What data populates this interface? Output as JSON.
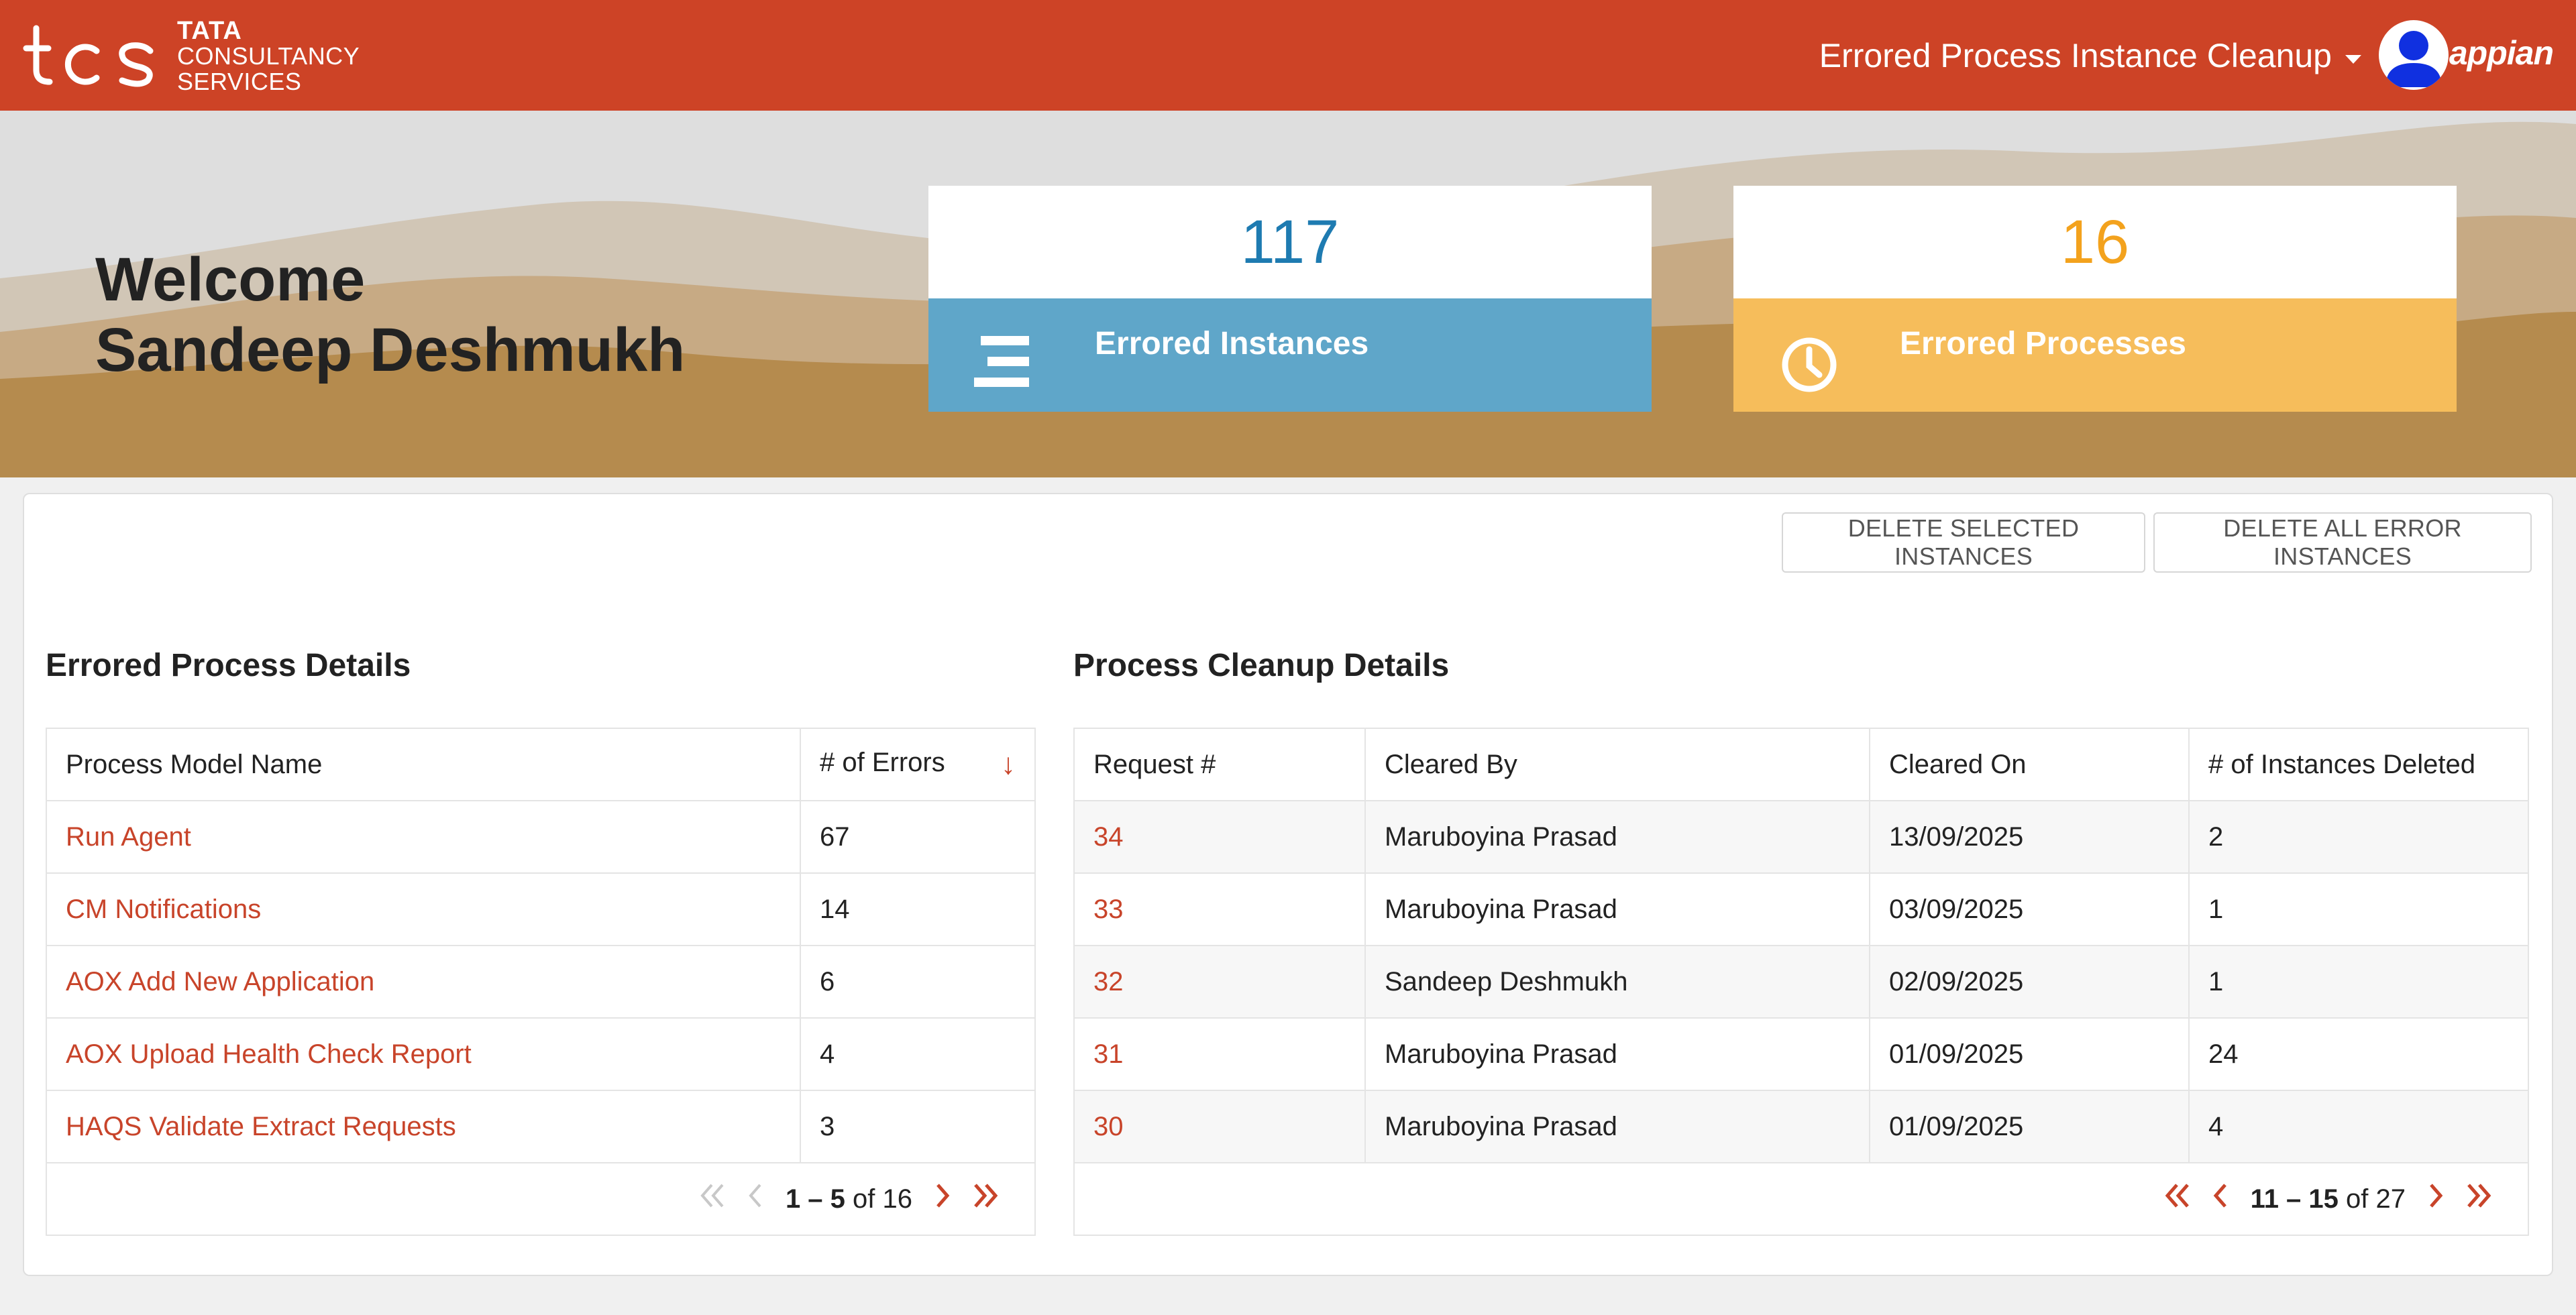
{
  "header": {
    "logo_line1": "TATA",
    "logo_line2": "CONSULTANCY",
    "logo_line3": "SERVICES",
    "app_title": "Errored Process Instance Cleanup",
    "brand": "appian"
  },
  "banner": {
    "welcome_line1": "Welcome",
    "welcome_line2": "Sandeep Deshmukh",
    "cards": [
      {
        "value": "117",
        "label": "Errored Instances",
        "icon": "list-icon",
        "color": "#5fa6c9"
      },
      {
        "value": "16",
        "label": "Errored Processes",
        "icon": "clock-icon",
        "color": "#f6bd5b"
      }
    ]
  },
  "actions": {
    "delete_selected": "DELETE SELECTED INSTANCES",
    "delete_all": "DELETE ALL ERROR INSTANCES"
  },
  "errored_process_details": {
    "title": "Errored Process Details",
    "columns": [
      "Process Model Name",
      "# of Errors"
    ],
    "rows": [
      {
        "name": "Run Agent",
        "errors": "67"
      },
      {
        "name": "CM Notifications",
        "errors": "14"
      },
      {
        "name": "AOX Add New Application",
        "errors": "6"
      },
      {
        "name": "AOX Upload Health Check Report",
        "errors": "4"
      },
      {
        "name": "HAQS Validate Extract Requests",
        "errors": "3"
      }
    ],
    "pager": {
      "range": "1 – 5",
      "of": "of 16"
    }
  },
  "process_cleanup_details": {
    "title": "Process Cleanup Details",
    "columns": [
      "Request #",
      "Cleared By",
      "Cleared On",
      "# of Instances Deleted"
    ],
    "rows": [
      {
        "request": "34",
        "cleared_by": "Maruboyina Prasad",
        "cleared_on": "13/09/2025",
        "deleted": "2"
      },
      {
        "request": "33",
        "cleared_by": "Maruboyina Prasad",
        "cleared_on": "03/09/2025",
        "deleted": "1"
      },
      {
        "request": "32",
        "cleared_by": "Sandeep Deshmukh",
        "cleared_on": "02/09/2025",
        "deleted": "1"
      },
      {
        "request": "31",
        "cleared_by": "Maruboyina Prasad",
        "cleared_on": "01/09/2025",
        "deleted": "24"
      },
      {
        "request": "30",
        "cleared_by": "Maruboyina Prasad",
        "cleared_on": "01/09/2025",
        "deleted": "4"
      }
    ],
    "pager": {
      "range": "11 – 15",
      "of": "of 27"
    }
  },
  "colors": {
    "header_red": "#cd4326",
    "link": "#c8442a",
    "accent_blue": "#1e7bb1",
    "accent_orange": "#f3a21d"
  }
}
